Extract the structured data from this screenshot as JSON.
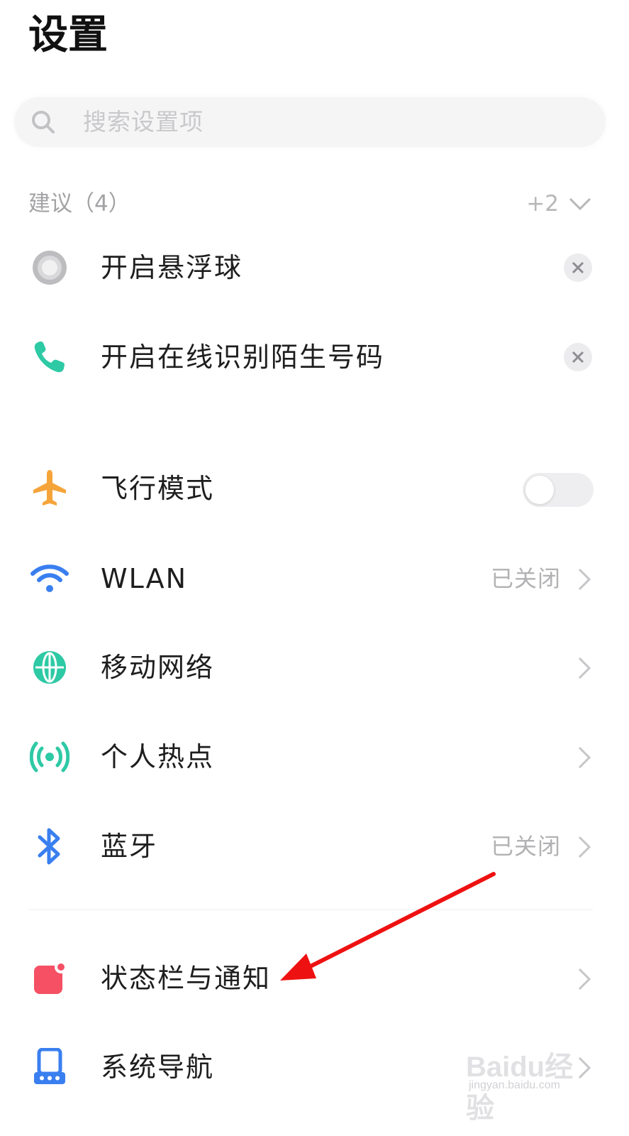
{
  "header": {
    "title": "设置"
  },
  "search": {
    "placeholder": "搜索设置项",
    "icon": "search-icon"
  },
  "suggestions": {
    "header_label": "建议（4）",
    "more_count": "+2",
    "items": [
      {
        "label": "开启悬浮球",
        "icon": "floating-ball-icon"
      },
      {
        "label": "开启在线识别陌生号码",
        "icon": "phone-icon",
        "icon_color": "#2ec9a5"
      }
    ]
  },
  "settings": {
    "items": [
      {
        "label": "飞行模式",
        "icon": "airplane-icon",
        "icon_color": "#f5a43a",
        "toggle_on": false
      },
      {
        "label": "WLAN",
        "icon": "wifi-icon",
        "icon_color": "#3a7ff0",
        "status": "已关闭"
      },
      {
        "label": "移动网络",
        "icon": "globe-icon",
        "icon_color": "#2ec9a5"
      },
      {
        "label": "个人热点",
        "icon": "hotspot-icon",
        "icon_color": "#2ec9a5"
      },
      {
        "label": "蓝牙",
        "icon": "bluetooth-icon",
        "icon_color": "#3a7ff0",
        "status": "已关闭"
      },
      {
        "label": "状态栏与通知",
        "icon": "notification-icon",
        "icon_color": "#f55064"
      },
      {
        "label": "系统导航",
        "icon": "navigation-icon",
        "icon_color": "#3a7ff0"
      }
    ]
  },
  "annotation": {
    "arrow_color": "#ee1111"
  },
  "watermark": {
    "brand": "Baidu经验",
    "domain": "jingyan.baidu.com"
  }
}
